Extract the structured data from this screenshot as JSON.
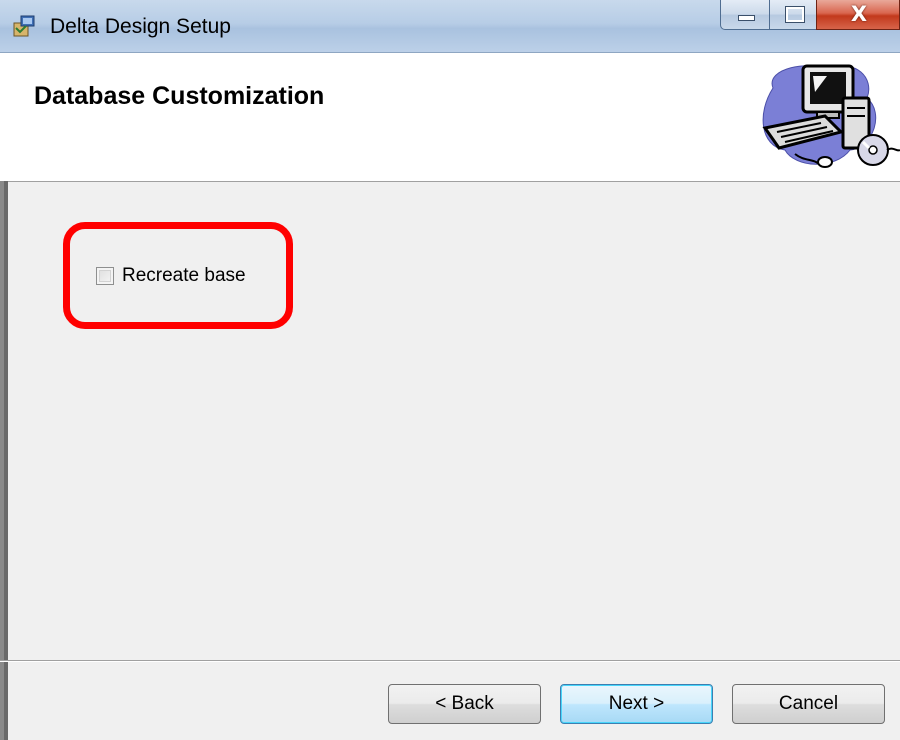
{
  "window": {
    "title": "Delta Design Setup",
    "title_icon": "setup-package-icon",
    "caption_buttons": {
      "minimize_icon": "minimize-icon",
      "maximize_icon": "maximize-icon",
      "close_glyph": "X"
    }
  },
  "banner": {
    "title": "Database Customization",
    "art_icon": "computer-clipart-icon"
  },
  "content": {
    "recreate_checkbox": {
      "label": "Recreate base",
      "checked": false
    },
    "highlight_color": "#ff0000"
  },
  "footer": {
    "back_label": "< Back",
    "next_label": "Next >",
    "cancel_label": "Cancel"
  }
}
